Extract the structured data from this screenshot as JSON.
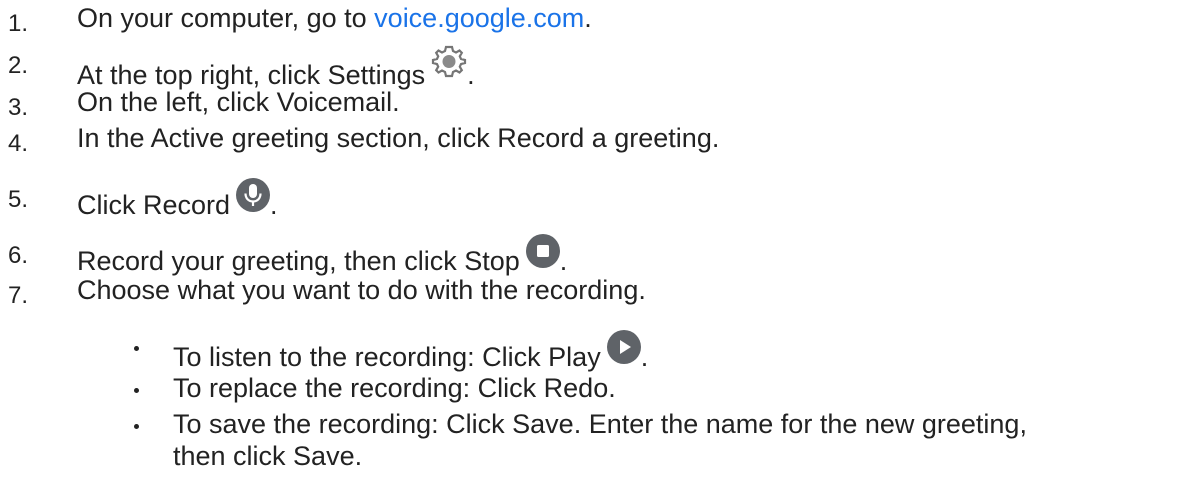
{
  "steps": [
    {
      "num": "1.",
      "before": "On your computer, go to ",
      "link": "voice.google.com",
      "after": "."
    },
    {
      "num": "2.",
      "text": "At the top right, click Settings",
      "after": ".",
      "icon": "gear-icon"
    },
    {
      "num": "3.",
      "text": "On the left, click Voicemail."
    },
    {
      "num": "4.",
      "text": "In the Active greeting section, click Record a greeting."
    },
    {
      "num": "5.",
      "text": "Click Record",
      "after": ".",
      "icon": "microphone-icon"
    },
    {
      "num": "6.",
      "text": "Record your greeting, then click Stop",
      "after": ".",
      "icon": "stop-icon"
    },
    {
      "num": "7.",
      "text": "Choose what you want to do with the recording."
    }
  ],
  "bullets": [
    {
      "text": "To listen to the recording: Click Play",
      "after": ".",
      "icon": "play-icon"
    },
    {
      "text": "To replace the recording: Click Redo."
    },
    {
      "text": "To save the recording: Click Save. Enter the name for the new greeting,",
      "continuation": "then click Save."
    }
  ],
  "colors": {
    "text": "#222222",
    "link": "#1a73e8",
    "icon_gray": "#5f6368",
    "gear_gray": "#757575"
  }
}
